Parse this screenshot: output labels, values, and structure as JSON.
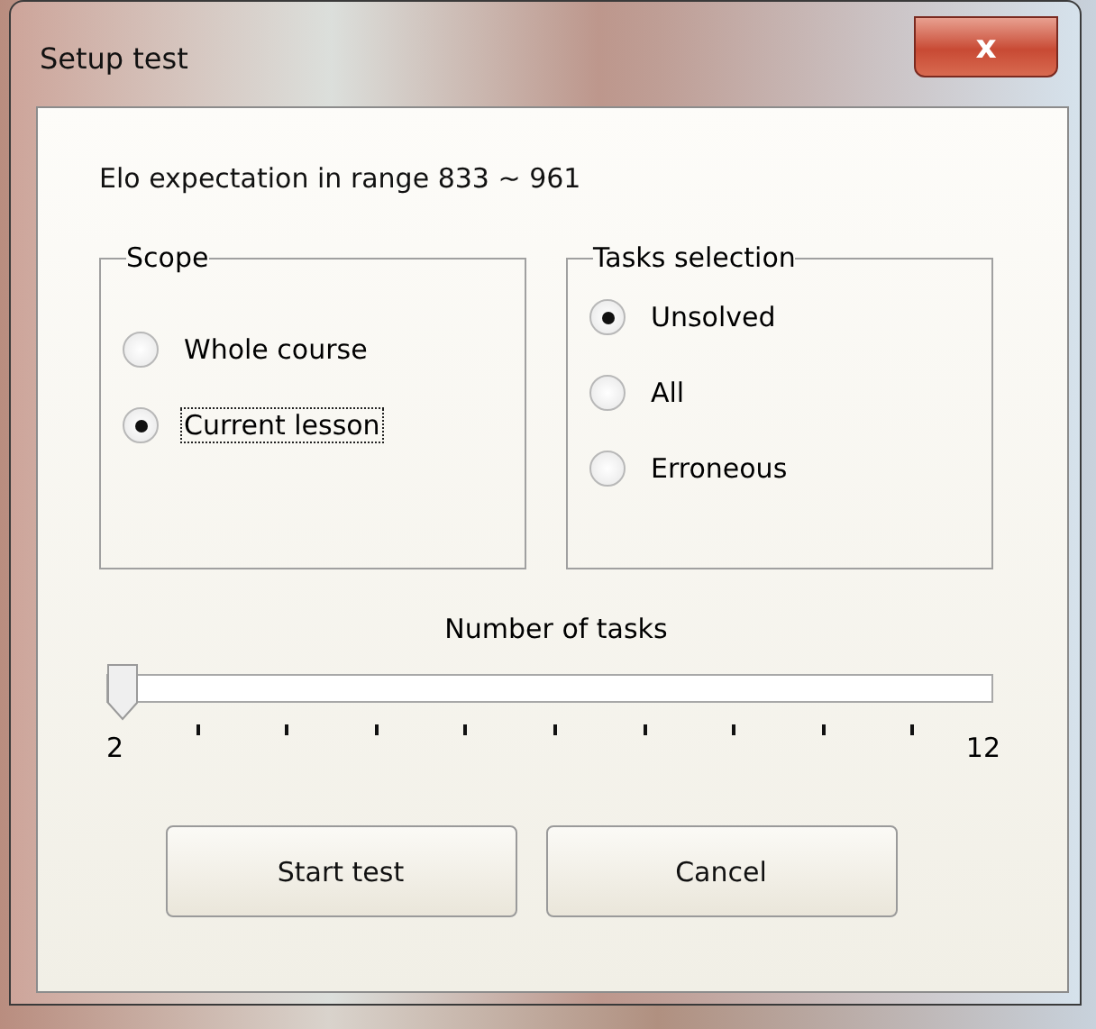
{
  "window": {
    "title": "Setup test",
    "close_button": "x"
  },
  "info": "Elo expectation in range 833 ~ 961",
  "groups": [
    {
      "title": "Scope",
      "options": [
        {
          "label": "Whole course",
          "selected": false,
          "focused": false
        },
        {
          "label": "Current lesson",
          "selected": true,
          "focused": true
        }
      ]
    },
    {
      "title": "Tasks selection",
      "options": [
        {
          "label": "Unsolved",
          "selected": true,
          "focused": false
        },
        {
          "label": "All",
          "selected": false,
          "focused": false
        },
        {
          "label": "Erroneous",
          "selected": false,
          "focused": false
        }
      ]
    }
  ],
  "slider": {
    "label": "Number of tasks",
    "min_label": "2",
    "max_label": "12",
    "level": 0
  },
  "buttons": [
    "Start test",
    "Cancel"
  ]
}
